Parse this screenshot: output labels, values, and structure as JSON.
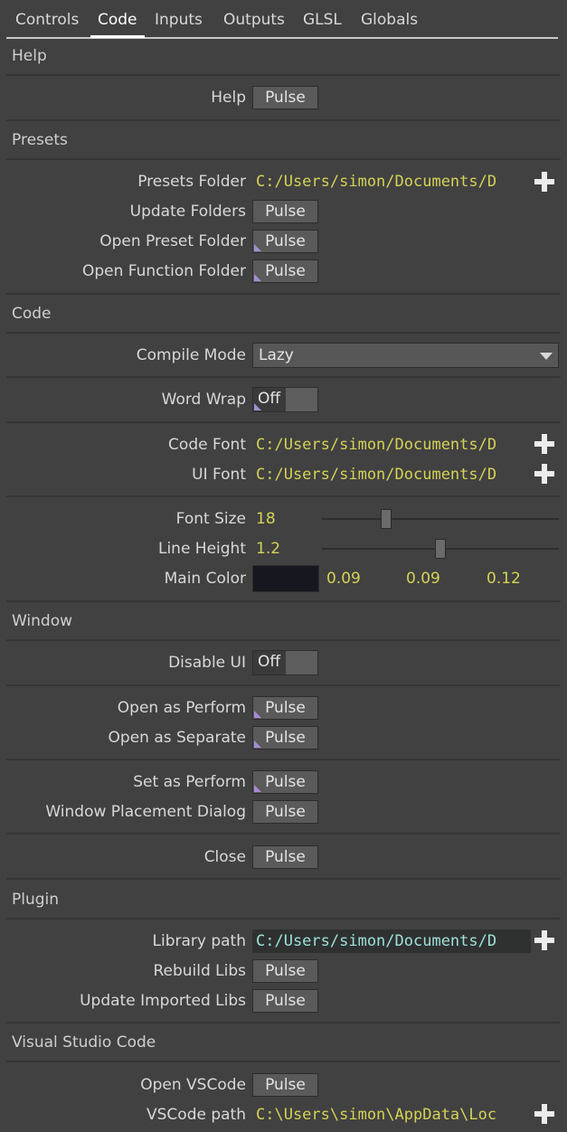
{
  "tabs": [
    "Controls",
    "Code",
    "Inputs",
    "Outputs",
    "GLSL",
    "Globals"
  ],
  "active_tab": "Code",
  "pulse_label": "Pulse",
  "sections": {
    "help": "Help",
    "presets": "Presets",
    "code": "Code",
    "window": "Window",
    "plugin": "Plugin",
    "vscode": "Visual Studio Code"
  },
  "help": {
    "help_label": "Help"
  },
  "presets": {
    "presets_folder_label": "Presets Folder",
    "presets_folder_value": "C:/Users/simon/Documents/D",
    "update_folders_label": "Update Folders",
    "open_preset_folder_label": "Open Preset Folder",
    "open_function_folder_label": "Open Function Folder"
  },
  "code": {
    "compile_mode_label": "Compile Mode",
    "compile_mode_value": "Lazy",
    "word_wrap_label": "Word Wrap",
    "word_wrap_value": "Off",
    "code_font_label": "Code Font",
    "code_font_value": "C:/Users/simon/Documents/D",
    "ui_font_label": "UI Font",
    "ui_font_value": "C:/Users/simon/Documents/D",
    "font_size_label": "Font Size",
    "font_size_value": "18",
    "font_size_fraction": 0.27,
    "line_height_label": "Line Height",
    "line_height_value": "1.2",
    "line_height_fraction": 0.5,
    "main_color_label": "Main Color",
    "main_color_r": "0.09",
    "main_color_g": "0.09",
    "main_color_b": "0.12",
    "main_color_hex": "#17171f"
  },
  "window": {
    "disable_ui_label": "Disable UI",
    "disable_ui_value": "Off",
    "open_as_perform_label": "Open as Perform",
    "open_as_separate_label": "Open as Separate",
    "set_as_perform_label": "Set as Perform",
    "window_placement_label": "Window Placement Dialog",
    "close_label": "Close"
  },
  "plugin": {
    "library_path_label": "Library path",
    "library_path_value": "C:/Users/simon/Documents/D",
    "rebuild_libs_label": "Rebuild Libs",
    "update_imported_libs_label": "Update Imported Libs"
  },
  "vscode": {
    "open_vscode_label": "Open VSCode",
    "vscode_path_label": "VSCode path",
    "vscode_path_value": "C:\\Users\\simon\\AppData\\Loc"
  },
  "colors": {
    "background": "#414141",
    "path_text": "#d4d256",
    "pulse_indicator": "#a78bd8"
  }
}
